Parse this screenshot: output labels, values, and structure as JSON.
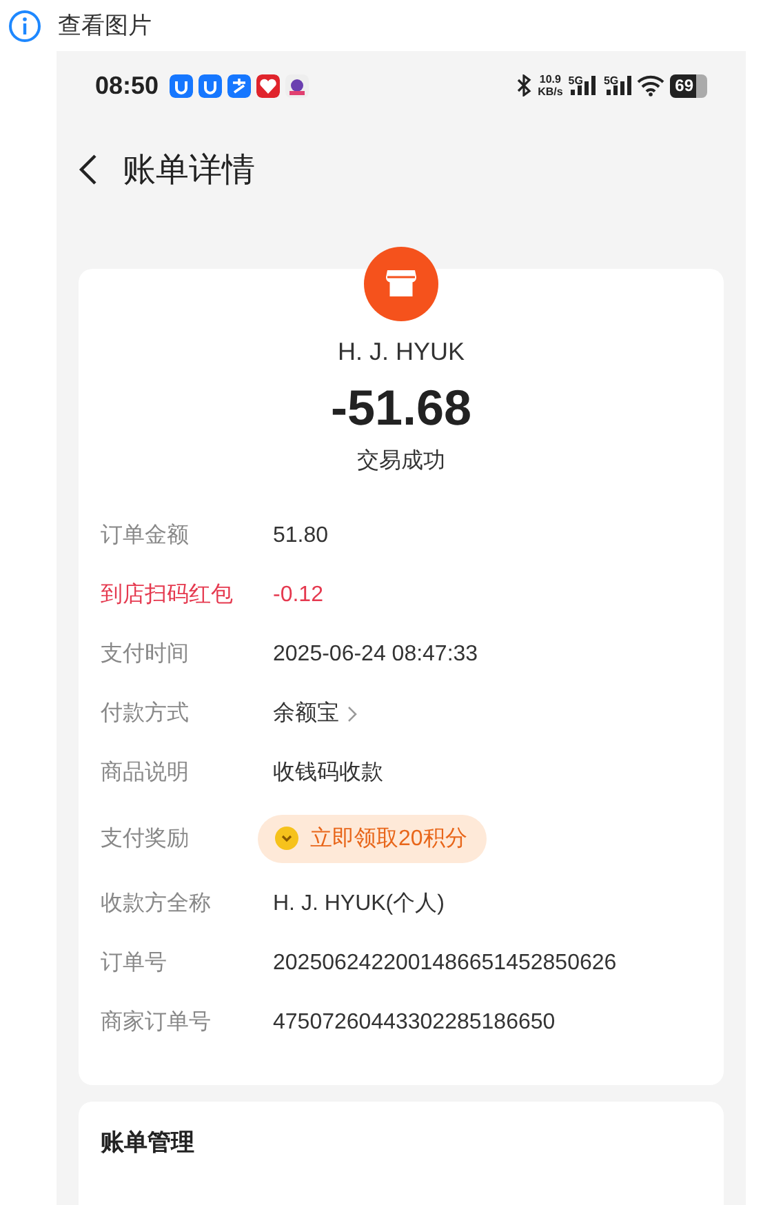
{
  "viewer": {
    "title": "查看图片"
  },
  "status_bar": {
    "time": "08:50",
    "net_speed": "10.9",
    "net_unit": "KB/s",
    "signals": [
      "5G",
      "5G"
    ],
    "battery": "69"
  },
  "header": {
    "title": "账单详情"
  },
  "bill": {
    "merchant": "H. J. HYUK",
    "amount": "-51.68",
    "status": "交易成功",
    "rows": [
      {
        "kind": "plain",
        "label": "订单金额",
        "value": "51.80"
      },
      {
        "kind": "discount",
        "label": "到店扫码红包",
        "value": "-0.12"
      },
      {
        "kind": "plain",
        "label": "支付时间",
        "value": "2025-06-24 08:47:33"
      },
      {
        "kind": "link",
        "label": "付款方式",
        "value": "余额宝"
      },
      {
        "kind": "plain",
        "label": "商品说明",
        "value": "收钱码收款"
      },
      {
        "kind": "reward",
        "label": "支付奖励",
        "value": "立即领取20积分"
      },
      {
        "kind": "plain",
        "label": "收款方全称",
        "value": "H. J. HYUK(个人)"
      },
      {
        "kind": "plain",
        "label": "订单号",
        "value": "2025062422001486651452850626"
      },
      {
        "kind": "plain",
        "label": "商家订单号",
        "value": "47507260443302285186650"
      }
    ]
  },
  "manage": {
    "title": "账单管理"
  }
}
